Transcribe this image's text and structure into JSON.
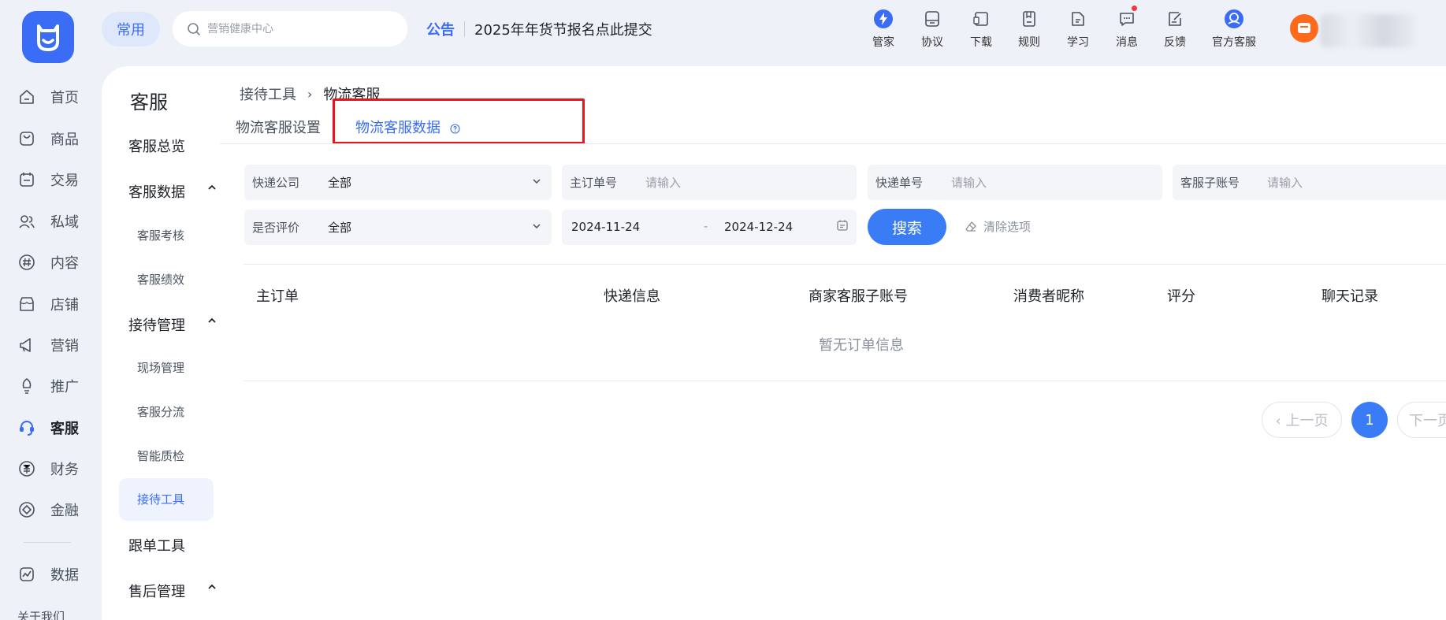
{
  "topbar": {
    "chip_label": "常用",
    "search_placeholder": "营销健康中心",
    "notice_tag": "公告",
    "notice_text": "2025年年货节报名点此提交",
    "nav": [
      {
        "label": "管家",
        "icon": "lightning-icon"
      },
      {
        "label": "协议",
        "icon": "protocol-icon"
      },
      {
        "label": "下载",
        "icon": "download-icon"
      },
      {
        "label": "规则",
        "icon": "rules-icon"
      },
      {
        "label": "学习",
        "icon": "learn-icon"
      },
      {
        "label": "消息",
        "icon": "message-icon"
      },
      {
        "label": "反馈",
        "icon": "feedback-icon"
      },
      {
        "label": "官方客服",
        "icon": "official-service-icon"
      }
    ]
  },
  "rail": {
    "items": [
      {
        "label": "首页",
        "icon": "home-icon"
      },
      {
        "label": "商品",
        "icon": "goods-icon"
      },
      {
        "label": "交易",
        "icon": "trade-icon"
      },
      {
        "label": "私域",
        "icon": "private-domain-icon"
      },
      {
        "label": "内容",
        "icon": "content-icon"
      },
      {
        "label": "店铺",
        "icon": "store-icon"
      },
      {
        "label": "营销",
        "icon": "marketing-icon"
      },
      {
        "label": "推广",
        "icon": "promotion-icon"
      },
      {
        "label": "客服",
        "icon": "customer-service-icon"
      },
      {
        "label": "财务",
        "icon": "finance-icon"
      },
      {
        "label": "金融",
        "icon": "banking-icon"
      },
      {
        "label": "数据",
        "icon": "data-icon"
      }
    ],
    "active": "客服",
    "cut_off_label": "关于我们"
  },
  "side": {
    "title": "客服",
    "overview": "客服总览",
    "group1": "客服数据",
    "group1_items": [
      "客服考核",
      "客服绩效"
    ],
    "group2": "接待管理",
    "group2_items": [
      "现场管理",
      "客服分流",
      "智能质检",
      "接待工具"
    ],
    "active_item": "接待工具",
    "follow": "跟单工具",
    "after_sales": "售后管理"
  },
  "breadcrumb": {
    "parent": "接待工具",
    "current": "物流客服"
  },
  "tabs": {
    "settings": "物流客服设置",
    "data": "物流客服数据"
  },
  "filters": {
    "courier_label": "快递公司",
    "courier_value": "全部",
    "order_label": "主订单号",
    "order_placeholder": "请输入",
    "tracking_label": "快递单号",
    "tracking_placeholder": "请输入",
    "subaccount_label": "客服子账号",
    "subaccount_placeholder": "请输入",
    "rated_label": "是否评价",
    "rated_value": "全部",
    "date_start": "2024-11-24",
    "date_separator": "-",
    "date_end": "2024-12-24",
    "search_button": "搜索",
    "clear_button": "清除选项"
  },
  "table": {
    "columns": [
      "主订单",
      "快递信息",
      "商家客服子账号",
      "消费者昵称",
      "评分",
      "聊天记录"
    ],
    "empty_text": "暂无订单信息"
  },
  "pagination": {
    "prev": "‹ 上一页",
    "current_page": "1",
    "next": "下一页"
  },
  "colors": {
    "accent": "#3a6cf5",
    "highlight_border": "#e8141c",
    "badge": "#f2353e"
  }
}
